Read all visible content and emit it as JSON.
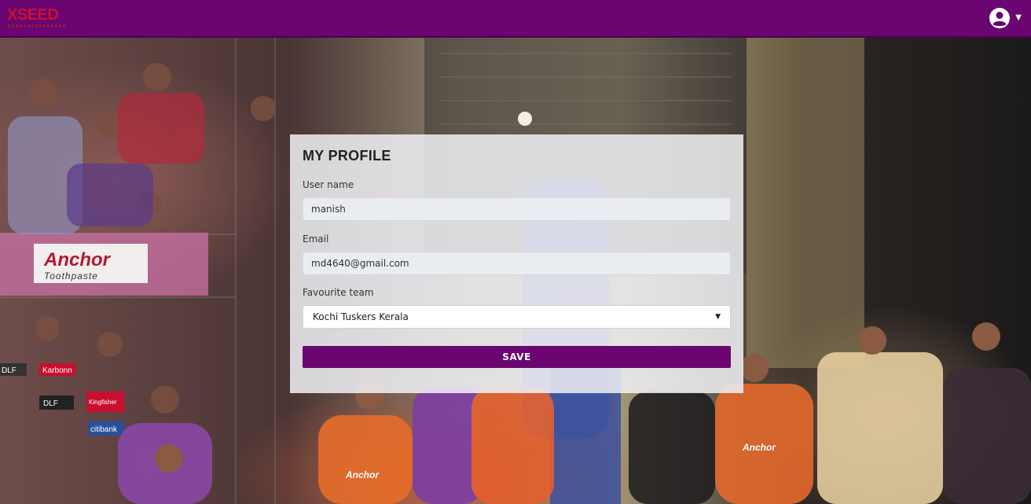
{
  "navbar": {
    "logo_text": "XSEED",
    "brand_color": "#6a0572",
    "logo_color": "#c8102e",
    "user_icon": "user-circle-icon",
    "menu_icon": "caret-down-icon"
  },
  "background": {
    "description_icon": "cricket-stadium-photo",
    "banners": [
      "Anchor",
      "Toothpaste",
      "Karbonn",
      "DLF",
      "Kingfisher",
      "citibank"
    ]
  },
  "profile": {
    "title": "MY PROFILE",
    "username_label": "User name",
    "username_value": "manish",
    "email_label": "Email",
    "email_value": "md4640@gmail.com",
    "team_label": "Favourite team",
    "team_value": "Kochi Tuskers Kerala",
    "save_label": "SAVE"
  }
}
